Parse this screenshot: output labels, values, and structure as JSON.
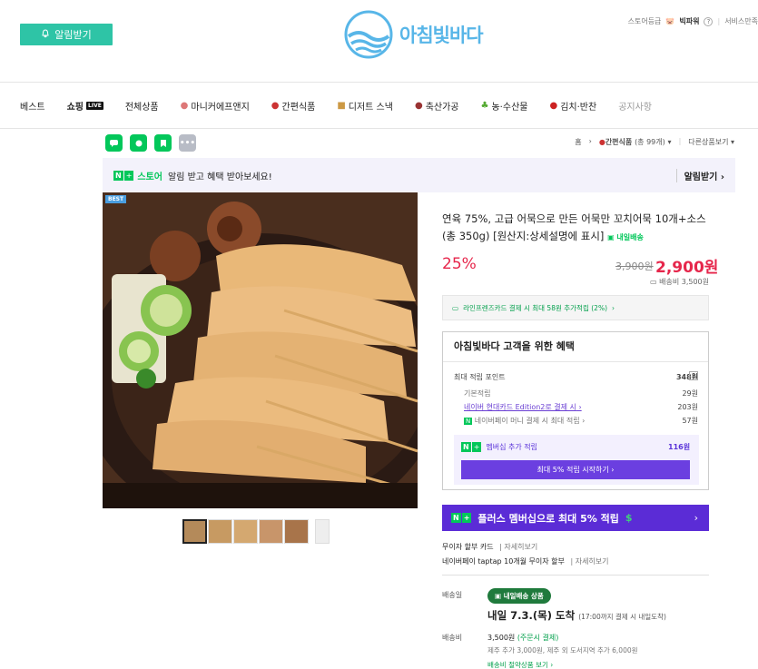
{
  "header": {
    "notify_label": "알림받기",
    "brand": "아침빛바다",
    "store_grade_label": "스토어등급",
    "store_grade": "빅파워",
    "service_label": "서비스만족"
  },
  "nav": {
    "items": [
      "베스트",
      "쇼핑",
      "전체상품",
      "마니커에프앤지",
      "간편식품",
      "디저트 스낵",
      "축산가공",
      "농·수산물",
      "김치·반찬",
      "공지사항"
    ],
    "live_badge": "LIVE"
  },
  "breadcrumb": {
    "home": "홈",
    "category": "간편식품",
    "count": "(총 99개)",
    "other": "다른상품보기"
  },
  "alert_banner": {
    "store_label": "스토어",
    "message": "알림 받고 혜택 받아보세요!",
    "action": "알림받기"
  },
  "product": {
    "best_badge": "BEST",
    "title": "연육 75%, 고급 어묵으로 만든 어묵만 꼬치어묵 10개+소스 (총 350g) [원산지:상세설명에 표시]",
    "tomorrow_tag": "내일배송",
    "discount": "25%",
    "original_price": "3,900원",
    "price": "2,900원",
    "shipping_fee": "배송비 3,500원",
    "card_benefit": "라인프렌즈카드 결제 시 최대 58원 추가적립 (2%)"
  },
  "benefits": {
    "title": "아침빛바다 고객을 위한 혜택",
    "max_points_label": "최대 적립 포인트",
    "max_points": "348원",
    "items": [
      {
        "label": "기본적립",
        "value": "29원"
      },
      {
        "label": "네이버 현대카드 Edition2로 결제 시",
        "value": "203원"
      },
      {
        "label": "네이버페이 머니 결제 시 최대 적립",
        "value": "57원"
      }
    ],
    "membership_label": "멤버십 추가 적립",
    "membership_points": "116원",
    "membership_button": "최대 5% 적립 시작하기"
  },
  "plus_banner": "플러스 멤버십으로 최대 5% 적립",
  "payment": [
    {
      "label": "무이자 할부 카드",
      "more": "자세히보기"
    },
    {
      "label": "네이버페이 taptap 10개월 무이자 할부",
      "more": "자세히보기"
    }
  ],
  "delivery": {
    "label": "배송일",
    "badge": "내일배송 상품",
    "arrival": "내일 7.3.(목) 도착",
    "arrival_note": "(17:00까지 결제 시 내일도착)",
    "fee_label": "배송비",
    "fee": "3,500원",
    "fee_pay": "(주문시 결제)",
    "extra": "제주 추가 3,000원, 제주 외 도서지역 추가 6,000원",
    "combine": "배송비 절약상품 보기"
  },
  "colors": {
    "notify_green": "#2ec4a6",
    "brand_blue": "#58b6e8",
    "naver_green": "#03c75a",
    "price_red": "#e6264b",
    "membership_purple": "#5b2cd6"
  }
}
